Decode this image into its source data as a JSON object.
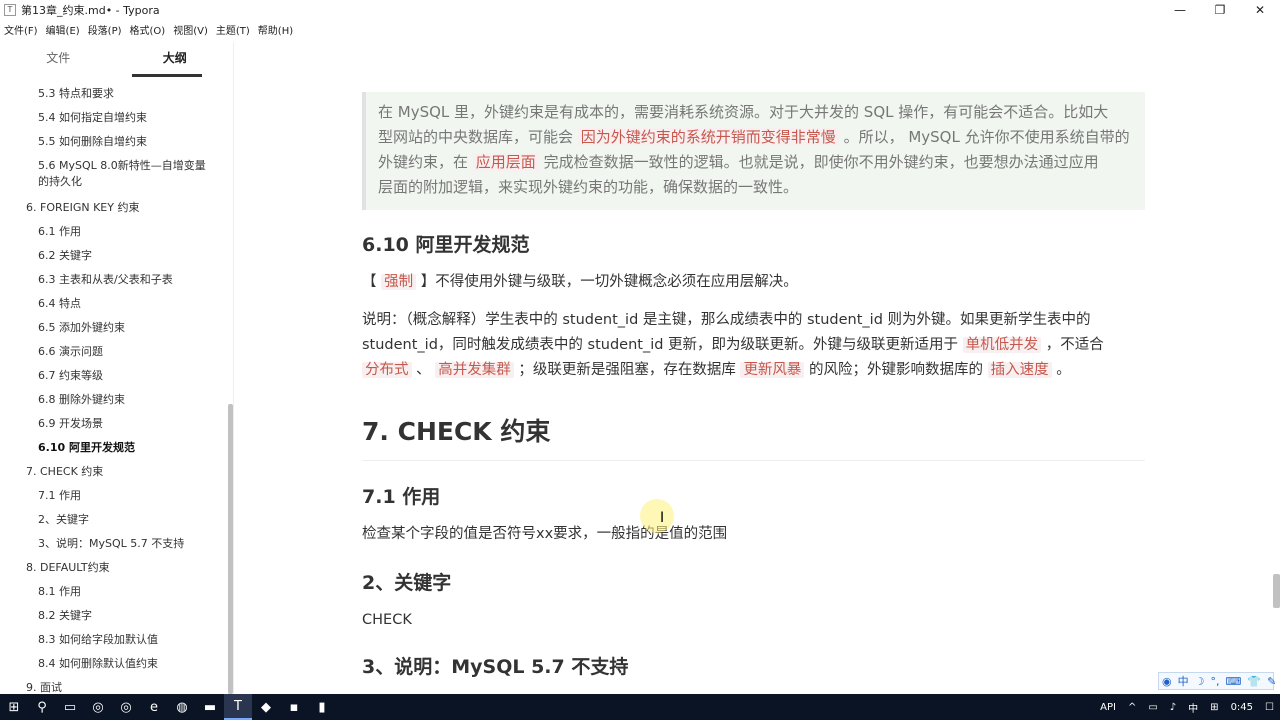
{
  "window": {
    "title": "第13章_约束.md• - Typora",
    "minimize": "—",
    "maximize": "❐",
    "close": "✕"
  },
  "menu": [
    "文件(F)",
    "编辑(E)",
    "段落(P)",
    "格式(O)",
    "视图(V)",
    "主题(T)",
    "帮助(H)"
  ],
  "sidebar": {
    "tabs": [
      "文件",
      "大纲"
    ],
    "active_tab": "大纲",
    "items": [
      {
        "label": "5.3 特点和要求",
        "level": 2
      },
      {
        "label": "5.4 如何指定自增约束",
        "level": 2
      },
      {
        "label": "5.5 如何删除自增约束",
        "level": 2
      },
      {
        "label": "5.6 MySQL 8.0新特性—自增变量的持久化",
        "level": 2
      },
      {
        "label": "6. FOREIGN KEY 约束",
        "level": 1
      },
      {
        "label": "6.1 作用",
        "level": 2
      },
      {
        "label": "6.2 关键字",
        "level": 2
      },
      {
        "label": "6.3 主表和从表/父表和子表",
        "level": 2
      },
      {
        "label": "6.4 特点",
        "level": 2
      },
      {
        "label": "6.5 添加外键约束",
        "level": 2
      },
      {
        "label": "6.6 演示问题",
        "level": 2
      },
      {
        "label": "6.7 约束等级",
        "level": 2
      },
      {
        "label": "6.8 删除外键约束",
        "level": 2
      },
      {
        "label": "6.9 开发场景",
        "level": 2
      },
      {
        "label": "6.10 阿里开发规范",
        "level": 2
      },
      {
        "label": "7. CHECK 约束",
        "level": 1
      },
      {
        "label": "7.1 作用",
        "level": 2
      },
      {
        "label": "2、关键字",
        "level": 2
      },
      {
        "label": "3、说明：MySQL 5.7 不支持",
        "level": 2
      },
      {
        "label": "8. DEFAULT约束",
        "level": 1
      },
      {
        "label": "8.1 作用",
        "level": 2
      },
      {
        "label": "8.2 关键字",
        "level": 2
      },
      {
        "label": "8.3 如何给字段加默认值",
        "level": 2
      },
      {
        "label": "8.4 如何删除默认值约束",
        "level": 2
      },
      {
        "label": "9. 面试",
        "level": 1
      }
    ],
    "active_item": "6.10 阿里开发规范",
    "footer_back": "<",
    "footer_source": "</>"
  },
  "doc": {
    "quote": {
      "line1": "在 MySQL 里，外键约束是有成本的，需要消耗系统资源。对于大并发的 SQL 操作，有可能会不适合。比如大",
      "line2a": "型网站的中央数据库，可能会 ",
      "hl1": "因为外键约束的系统开销而变得非常慢",
      "line2b": " 。所以， MySQL 允许你不使用系统自带的",
      "line3a": "外键约束，在 ",
      "hl2": "应用层面",
      "line3b": " 完成检查数据一致性的逻辑。也就是说，即使你不用外键约束，也要想办法通过应用",
      "line4": "层面的附加逻辑，来实现外键约束的功能，确保数据的一致性。"
    },
    "h_610": "6.10 阿里开发规范",
    "rule": {
      "open": "【 ",
      "hl": "强制",
      "close": " 】不得使用外键与级联，一切外键概念必须在应用层解决。"
    },
    "explain": {
      "line1": "说明：（概念解释）学生表中的 student_id 是主键，那么成绩表中的 student_id 则为外键。如果更新学生表中的",
      "line2a": "student_id，同时触发成绩表中的 student_id 更新，即为级联更新。外键与级联更新适用于 ",
      "hl1": "单机低并发",
      "line2b": " ，不适合",
      "hl2": "分布式",
      "sep": " 、 ",
      "hl3": "高并发集群",
      "line3a": " ；级联更新是强阻塞，存在数据库 ",
      "hl4": "更新风暴",
      "line3b": " 的风险；外键影响数据库的 ",
      "hl5": "插入速度",
      "line3c": " 。"
    },
    "h_7": "7. CHECK 约束",
    "h_71": "7.1 作用",
    "p_71": "检查某个字段的值是否符号xx要求，一般指的是值的范围",
    "h_2": "2、关键字",
    "p_2": "CHECK",
    "h_3": "3、说明：MySQL 5.7 不支持"
  },
  "ime": [
    "中",
    "☽",
    "°,",
    "⌨",
    "👕",
    "✎"
  ],
  "taskbar": {
    "tray_api": "API",
    "lang": "中",
    "time": "0:45"
  }
}
